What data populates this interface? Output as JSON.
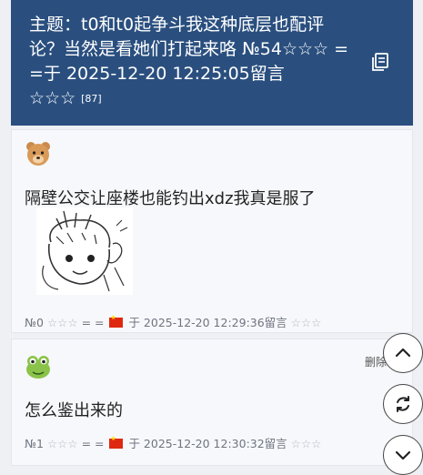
{
  "topic": {
    "title": "主题：t0和t0起争斗我这种底层也配评论？当然是看她们打起来咯 №54☆☆☆ = =于 2025-12-20 12:25:05留言☆☆☆",
    "count": "[87]"
  },
  "posts": [
    {
      "message": "隔壁公交让座楼也能钓出xdz我真是服了",
      "floor": "№0",
      "stars": "☆☆☆",
      "author": "= =",
      "datetime": "于 2025-12-20 12:29:36留言",
      "avatar": "bear-icon",
      "has_image": true
    },
    {
      "message": "怎么鉴出来的",
      "floor": "№1",
      "stars": "☆☆☆",
      "author": "= =",
      "datetime": "于 2025-12-20 12:30:32留言",
      "avatar": "frog-icon"
    }
  ],
  "actions": {
    "delete_label": "删除"
  }
}
